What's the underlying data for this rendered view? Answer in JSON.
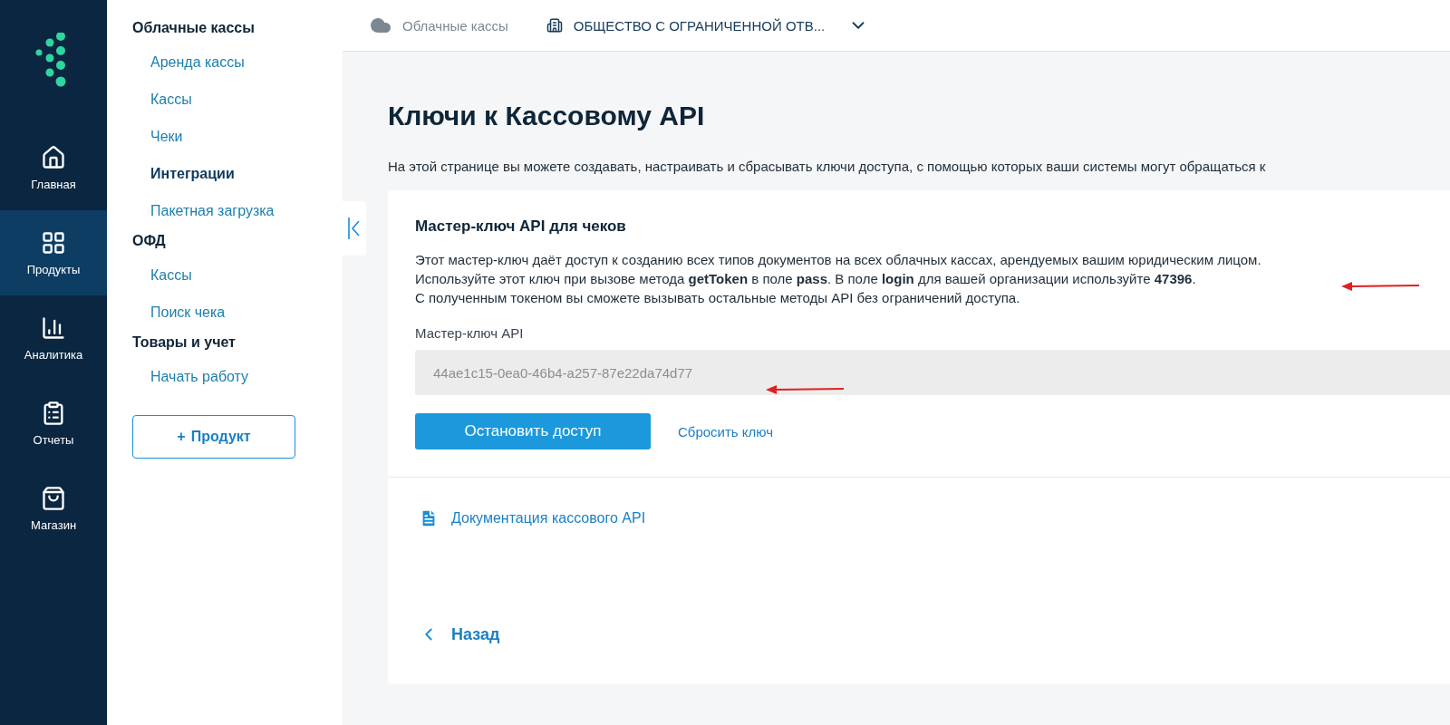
{
  "rail": {
    "items": [
      {
        "kind": "home",
        "label": "Главная",
        "selected": false
      },
      {
        "kind": "products",
        "label": "Продукты",
        "selected": true
      },
      {
        "kind": "analytics",
        "label": "Аналитика",
        "selected": false
      },
      {
        "kind": "reports",
        "label": "Отчеты",
        "selected": false
      },
      {
        "kind": "shop",
        "label": "Магазин",
        "selected": false
      }
    ]
  },
  "sidebar": {
    "sections": [
      {
        "title": "Облачные кассы",
        "items": [
          {
            "label": "Аренда кассы",
            "selected": false
          },
          {
            "label": "Кассы",
            "selected": false
          },
          {
            "label": "Чеки",
            "selected": false
          },
          {
            "label": "Интеграции",
            "selected": true
          },
          {
            "label": "Пакетная загрузка",
            "selected": false
          }
        ]
      },
      {
        "title": "ОФД",
        "items": [
          {
            "label": "Кассы",
            "selected": false
          },
          {
            "label": "Поиск чека",
            "selected": false
          }
        ]
      },
      {
        "title": "Товары и учет",
        "items": [
          {
            "label": "Начать работу",
            "selected": false
          }
        ]
      }
    ],
    "add_button": {
      "icon": "+",
      "label": "Продукт"
    }
  },
  "topbar": {
    "service": "Облачные кассы",
    "organization": "ОБЩЕСТВО С ОГРАНИЧЕННОЙ ОТВ..."
  },
  "page": {
    "title": "Ключи к Кассовому API",
    "description": "На этой странице вы можете создавать, настраивать и сбрасывать ключи доступа, с помощью которых ваши системы могут обращаться к"
  },
  "card": {
    "title": "Мастер-ключ API для чеков",
    "lines": [
      "Этот мастер-ключ даёт доступ к созданию всех типов документов на всех облачных кассах, арендуемых вашим юридическим лицом.",
      "Используйте этот ключ при вызове метода **getToken** в поле **pass**. В поле **login** для вашей организации используйте **47396**.",
      "С полученным токеном вы сможете вызывать остальные методы API без ограничений доступа."
    ],
    "field_label": "Мастер-ключ API",
    "field_value": "44ae1c15-0ea0-46b4-a257-87e22da74d77",
    "primary_button": "Остановить доступ",
    "link_button": "Сбросить ключ",
    "doc_link": "Документация кассового API",
    "back_link": "Назад"
  }
}
